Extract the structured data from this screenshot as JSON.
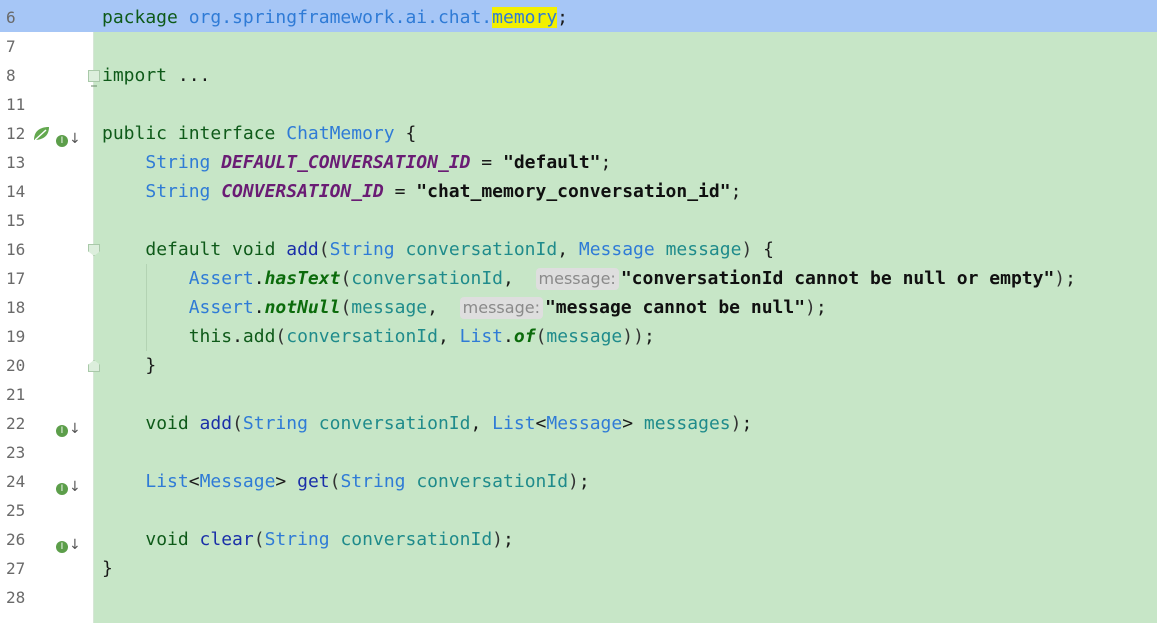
{
  "editor": {
    "lines": [
      {
        "num": "6",
        "current": true,
        "tokens": [
          {
            "t": "package ",
            "c": "kw"
          },
          {
            "t": "org.springframework.ai.chat.",
            "c": "pkg"
          },
          {
            "t": "memory",
            "c": "pkg hl"
          },
          {
            "t": ";",
            "c": ""
          }
        ]
      },
      {
        "num": "7",
        "tokens": []
      },
      {
        "num": "8",
        "tokens": [
          {
            "t": "import ",
            "c": "kw"
          },
          {
            "t": "...",
            "c": ""
          }
        ]
      },
      {
        "num": "11",
        "tokens": []
      },
      {
        "num": "12",
        "tokens": [
          {
            "t": "public interface ",
            "c": "kw"
          },
          {
            "t": "ChatMemory",
            "c": "cls"
          },
          {
            "t": " {",
            "c": ""
          }
        ]
      },
      {
        "num": "13",
        "tokens": [
          {
            "t": "    ",
            "c": ""
          },
          {
            "t": "String ",
            "c": "cls"
          },
          {
            "t": "DEFAULT_CONVERSATION_ID",
            "c": "fld"
          },
          {
            "t": " = ",
            "c": ""
          },
          {
            "t": "\"default\"",
            "c": "str"
          },
          {
            "t": ";",
            "c": ""
          }
        ]
      },
      {
        "num": "14",
        "tokens": [
          {
            "t": "    ",
            "c": ""
          },
          {
            "t": "String ",
            "c": "cls"
          },
          {
            "t": "CONVERSATION_ID",
            "c": "fld"
          },
          {
            "t": " = ",
            "c": ""
          },
          {
            "t": "\"chat_memory_conversation_id\"",
            "c": "str"
          },
          {
            "t": ";",
            "c": ""
          }
        ]
      },
      {
        "num": "15",
        "tokens": []
      },
      {
        "num": "16",
        "tokens": [
          {
            "t": "    ",
            "c": ""
          },
          {
            "t": "default void ",
            "c": "kw"
          },
          {
            "t": "add",
            "c": "meth"
          },
          {
            "t": "(",
            "c": "paren"
          },
          {
            "t": "String ",
            "c": "cls"
          },
          {
            "t": "conversationId",
            "c": "par"
          },
          {
            "t": ", ",
            "c": ""
          },
          {
            "t": "Message ",
            "c": "cls"
          },
          {
            "t": "message",
            "c": "par"
          },
          {
            "t": ")",
            "c": "paren"
          },
          {
            "t": " {",
            "c": ""
          }
        ]
      },
      {
        "num": "17",
        "tokens": [
          {
            "t": "        ",
            "c": ""
          },
          {
            "t": "Assert",
            "c": "cls"
          },
          {
            "t": ".",
            "c": ""
          },
          {
            "t": "hasText",
            "c": "smeth"
          },
          {
            "t": "(",
            "c": "paren"
          },
          {
            "t": "conversationId",
            "c": "par"
          },
          {
            "t": ",  ",
            "c": ""
          },
          {
            "t": "message:",
            "c": "hint"
          },
          {
            "t": "\"conversationId cannot be null or empty\"",
            "c": "str"
          },
          {
            "t": ")",
            "c": "paren"
          },
          {
            "t": ";",
            "c": ""
          }
        ]
      },
      {
        "num": "18",
        "tokens": [
          {
            "t": "        ",
            "c": ""
          },
          {
            "t": "Assert",
            "c": "cls"
          },
          {
            "t": ".",
            "c": ""
          },
          {
            "t": "notNull",
            "c": "smeth"
          },
          {
            "t": "(",
            "c": "paren"
          },
          {
            "t": "message",
            "c": "par"
          },
          {
            "t": ",  ",
            "c": ""
          },
          {
            "t": "message:",
            "c": "hint"
          },
          {
            "t": "\"message cannot be null\"",
            "c": "str"
          },
          {
            "t": ")",
            "c": "paren"
          },
          {
            "t": ";",
            "c": ""
          }
        ]
      },
      {
        "num": "19",
        "tokens": [
          {
            "t": "        ",
            "c": ""
          },
          {
            "t": "this",
            "c": "kw"
          },
          {
            "t": ".",
            "c": ""
          },
          {
            "t": "add",
            "c": "kw"
          },
          {
            "t": "(",
            "c": "paren"
          },
          {
            "t": "conversationId",
            "c": "par"
          },
          {
            "t": ", ",
            "c": ""
          },
          {
            "t": "List",
            "c": "cls"
          },
          {
            "t": ".",
            "c": ""
          },
          {
            "t": "of",
            "c": "smeth"
          },
          {
            "t": "(",
            "c": "paren"
          },
          {
            "t": "message",
            "c": "par"
          },
          {
            "t": "))",
            "c": "paren"
          },
          {
            "t": ";",
            "c": ""
          }
        ]
      },
      {
        "num": "20",
        "tokens": [
          {
            "t": "    }",
            "c": ""
          }
        ]
      },
      {
        "num": "21",
        "tokens": []
      },
      {
        "num": "22",
        "tokens": [
          {
            "t": "    ",
            "c": ""
          },
          {
            "t": "void ",
            "c": "kw"
          },
          {
            "t": "add",
            "c": "meth"
          },
          {
            "t": "(",
            "c": "paren"
          },
          {
            "t": "String ",
            "c": "cls"
          },
          {
            "t": "conversationId",
            "c": "par"
          },
          {
            "t": ", ",
            "c": ""
          },
          {
            "t": "List",
            "c": "cls"
          },
          {
            "t": "<",
            "c": ""
          },
          {
            "t": "Message",
            "c": "cls"
          },
          {
            "t": "> ",
            "c": ""
          },
          {
            "t": "messages",
            "c": "par"
          },
          {
            "t": ")",
            "c": "paren"
          },
          {
            "t": ";",
            "c": ""
          }
        ]
      },
      {
        "num": "23",
        "tokens": []
      },
      {
        "num": "24",
        "tokens": [
          {
            "t": "    ",
            "c": ""
          },
          {
            "t": "List",
            "c": "cls"
          },
          {
            "t": "<",
            "c": ""
          },
          {
            "t": "Message",
            "c": "cls"
          },
          {
            "t": "> ",
            "c": ""
          },
          {
            "t": "get",
            "c": "meth"
          },
          {
            "t": "(",
            "c": "paren"
          },
          {
            "t": "String ",
            "c": "cls"
          },
          {
            "t": "conversationId",
            "c": "par"
          },
          {
            "t": ")",
            "c": "paren"
          },
          {
            "t": ";",
            "c": ""
          }
        ]
      },
      {
        "num": "25",
        "tokens": []
      },
      {
        "num": "26",
        "tokens": [
          {
            "t": "    ",
            "c": ""
          },
          {
            "t": "void ",
            "c": "kw"
          },
          {
            "t": "clear",
            "c": "meth"
          },
          {
            "t": "(",
            "c": "paren"
          },
          {
            "t": "String ",
            "c": "cls"
          },
          {
            "t": "conversationId",
            "c": "par"
          },
          {
            "t": ")",
            "c": "paren"
          },
          {
            "t": ";",
            "c": ""
          }
        ]
      },
      {
        "num": "27",
        "tokens": [
          {
            "t": "}",
            "c": ""
          }
        ]
      },
      {
        "num": "28",
        "tokens": []
      }
    ],
    "gutter_icons": {
      "12": [
        "bean-leaf-icon",
        "implemented-icon"
      ],
      "22": [
        "implemented-icon"
      ],
      "24": [
        "implemented-icon"
      ],
      "26": [
        "implemented-icon"
      ]
    },
    "fold_markers": {
      "8": "fold-plus-icon",
      "16": "fold-minus-icon",
      "20": "fold-end-icon"
    }
  }
}
